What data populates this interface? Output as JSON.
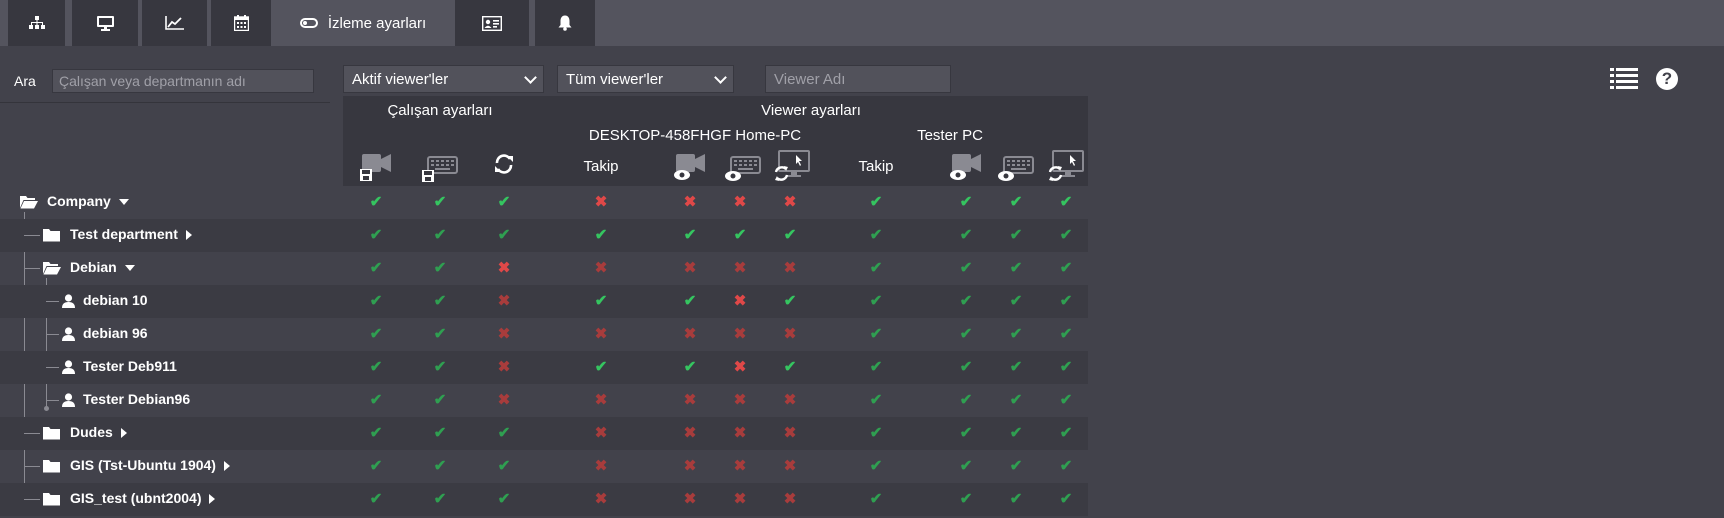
{
  "tabs": [
    {
      "name": "tab-org",
      "icon": "org-chart-icon",
      "label": ""
    },
    {
      "name": "tab-monitor",
      "icon": "monitor-icon",
      "label": ""
    },
    {
      "name": "tab-stats",
      "icon": "line-chart-icon",
      "label": ""
    },
    {
      "name": "tab-calendar",
      "icon": "calendar-icon",
      "label": ""
    },
    {
      "name": "tab-monitoring-settings",
      "icon": "toggle-icon",
      "label": "İzleme ayarları"
    },
    {
      "name": "tab-id-card",
      "icon": "id-card-icon",
      "label": ""
    },
    {
      "name": "tab-notifications",
      "icon": "bell-icon",
      "label": ""
    }
  ],
  "search": {
    "label": "Ara",
    "placeholder": "Çalışan veya departmanın adı"
  },
  "filters": {
    "viewer_status": "Aktif viewer'ler",
    "viewer_scope": "Tüm viewer'ler",
    "viewer_name_placeholder": "Viewer Adı"
  },
  "header": {
    "employee_settings": "Çalışan ayarları",
    "viewer_settings": "Viewer ayarları",
    "viewer1": "DESKTOP-458FHGF Home-PC",
    "viewer2": "Tester PC",
    "follow1": "Takip",
    "follow2": "Takip"
  },
  "colors": {
    "ok": "#35c560",
    "no": "#e04848",
    "bg": "#42424b",
    "header": "#37373f"
  },
  "rows": [
    {
      "label": "Company",
      "type": "folder-open",
      "caret": "down",
      "level": 0,
      "values": [
        "ok*",
        "ok*",
        "ok*",
        "no*",
        "no*",
        "no*",
        "no*",
        "ok*",
        "ok*",
        "ok*",
        "ok*"
      ]
    },
    {
      "label": "Test department",
      "type": "folder",
      "caret": "right",
      "level": 1,
      "values": [
        "ok",
        "ok",
        "ok",
        "ok*",
        "ok*",
        "ok*",
        "ok*",
        "ok",
        "ok",
        "ok",
        "ok"
      ]
    },
    {
      "label": "Debian",
      "type": "folder-open",
      "caret": "down",
      "level": 1,
      "values": [
        "ok",
        "ok",
        "no*",
        "no",
        "no",
        "no",
        "no",
        "ok",
        "ok",
        "ok",
        "ok"
      ]
    },
    {
      "label": "debian 10",
      "type": "user",
      "caret": "",
      "level": 2,
      "values": [
        "ok",
        "ok",
        "no",
        "ok*",
        "ok*",
        "no*",
        "ok*",
        "ok",
        "ok",
        "ok",
        "ok"
      ]
    },
    {
      "label": "debian 96",
      "type": "user",
      "caret": "",
      "level": 2,
      "values": [
        "ok",
        "ok",
        "no",
        "no",
        "no",
        "no",
        "no",
        "ok",
        "ok",
        "ok",
        "ok"
      ]
    },
    {
      "label": "Tester Deb911",
      "type": "user",
      "caret": "",
      "level": 2,
      "values": [
        "ok",
        "ok",
        "no",
        "ok*",
        "ok*",
        "no*",
        "ok*",
        "ok",
        "ok",
        "ok",
        "ok"
      ]
    },
    {
      "label": "Tester Debian96",
      "type": "user",
      "caret": "",
      "level": 2,
      "values": [
        "ok",
        "ok",
        "no",
        "no",
        "no",
        "no",
        "no",
        "ok",
        "ok",
        "ok",
        "ok"
      ]
    },
    {
      "label": "Dudes",
      "type": "folder",
      "caret": "right",
      "level": 1,
      "values": [
        "ok",
        "ok",
        "ok",
        "no",
        "no",
        "no",
        "no",
        "ok",
        "ok",
        "ok",
        "ok"
      ]
    },
    {
      "label": "GIS (Tst-Ubuntu 1904)",
      "type": "folder",
      "caret": "right",
      "level": 1,
      "values": [
        "ok",
        "ok",
        "ok",
        "no",
        "no",
        "no",
        "no",
        "ok",
        "ok",
        "ok",
        "ok"
      ]
    },
    {
      "label": "GIS_test (ubnt2004)",
      "type": "folder",
      "caret": "right",
      "level": 1,
      "values": [
        "ok",
        "ok",
        "ok",
        "no",
        "no",
        "no",
        "no",
        "ok",
        "ok",
        "ok",
        "ok"
      ]
    }
  ]
}
